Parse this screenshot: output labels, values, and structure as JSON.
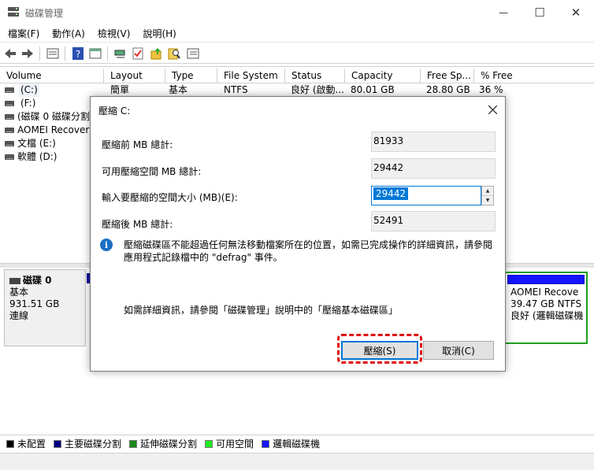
{
  "window": {
    "title": "磁碟管理",
    "minimize_glyph": "—",
    "maximize_glyph": "☐",
    "close_glyph": "✕"
  },
  "menu": [
    "檔案(F)",
    "動作(A)",
    "檢視(V)",
    "說明(H)"
  ],
  "toolbar_icons": [
    "back-arrow-icon",
    "forward-arrow-icon",
    "properties-icon",
    "help-icon",
    "console-icon",
    "connect-icon",
    "check-icon",
    "folder-up-icon",
    "search-icon",
    "list-icon"
  ],
  "table": {
    "columns": [
      "Volume",
      "Layout",
      "Type",
      "File System",
      "Status",
      "Capacity",
      "Free Sp...",
      "% Free"
    ],
    "rows": [
      [
        "(C:)",
        "簡單",
        "基本",
        "NTFS",
        "良好 (啟動...",
        "80.01 GB",
        "28.80 GB",
        "36 %"
      ],
      [
        "(F:)",
        "",
        "",
        "",
        "",
        "",
        "",
        ""
      ],
      [
        "(磁碟 0 磁碟分割",
        "",
        "",
        "",
        "",
        "",
        "",
        ""
      ],
      [
        "AOMEI Recovery",
        "",
        "",
        "",
        "",
        "",
        "",
        ""
      ],
      [
        "文檔 (E:)",
        "",
        "",
        "",
        "",
        "",
        "",
        ""
      ],
      [
        "軟體 (D:)",
        "",
        "",
        "",
        "",
        "",
        "",
        ""
      ]
    ]
  },
  "disk": {
    "name": "磁碟 0",
    "type": "基本",
    "size": "931.51 GB",
    "status": "連線"
  },
  "aomei_partition": {
    "name": "AOMEI Recove",
    "size": "39.47 GB NTFS",
    "status": "良好 (邏輯磁碟機"
  },
  "legend": [
    {
      "label": "未配置",
      "color": "#000000"
    },
    {
      "label": "主要磁碟分割",
      "color": "#000080"
    },
    {
      "label": "延伸磁碟分割",
      "color": "#1a8a1a"
    },
    {
      "label": "可用空間",
      "color": "#22ee22"
    },
    {
      "label": "邏輯磁碟機",
      "color": "#1414ff"
    }
  ],
  "dialog": {
    "title": "壓縮 C:",
    "total_before_label": "壓縮前 MB 總計:",
    "total_before_value": "81933",
    "available_label": "可用壓縮空間 MB 總計:",
    "available_value": "29442",
    "amount_label": "輸入要壓縮的空間大小 (MB)(E):",
    "amount_value": "29442",
    "total_after_label": "壓縮後 MB 總計:",
    "total_after_value": "52491",
    "info_text": "壓縮磁碟區不能超過任何無法移動檔案所在的位置，如需已完成操作的詳細資訊，請參閱應用程式記錄檔中的 \"defrag\" 事件。",
    "help_text": "如需詳細資訊，請參閱「磁碟管理」說明中的「壓縮基本磁碟區」",
    "shrink_button": "壓縮(S)",
    "cancel_button": "取消(C)"
  }
}
